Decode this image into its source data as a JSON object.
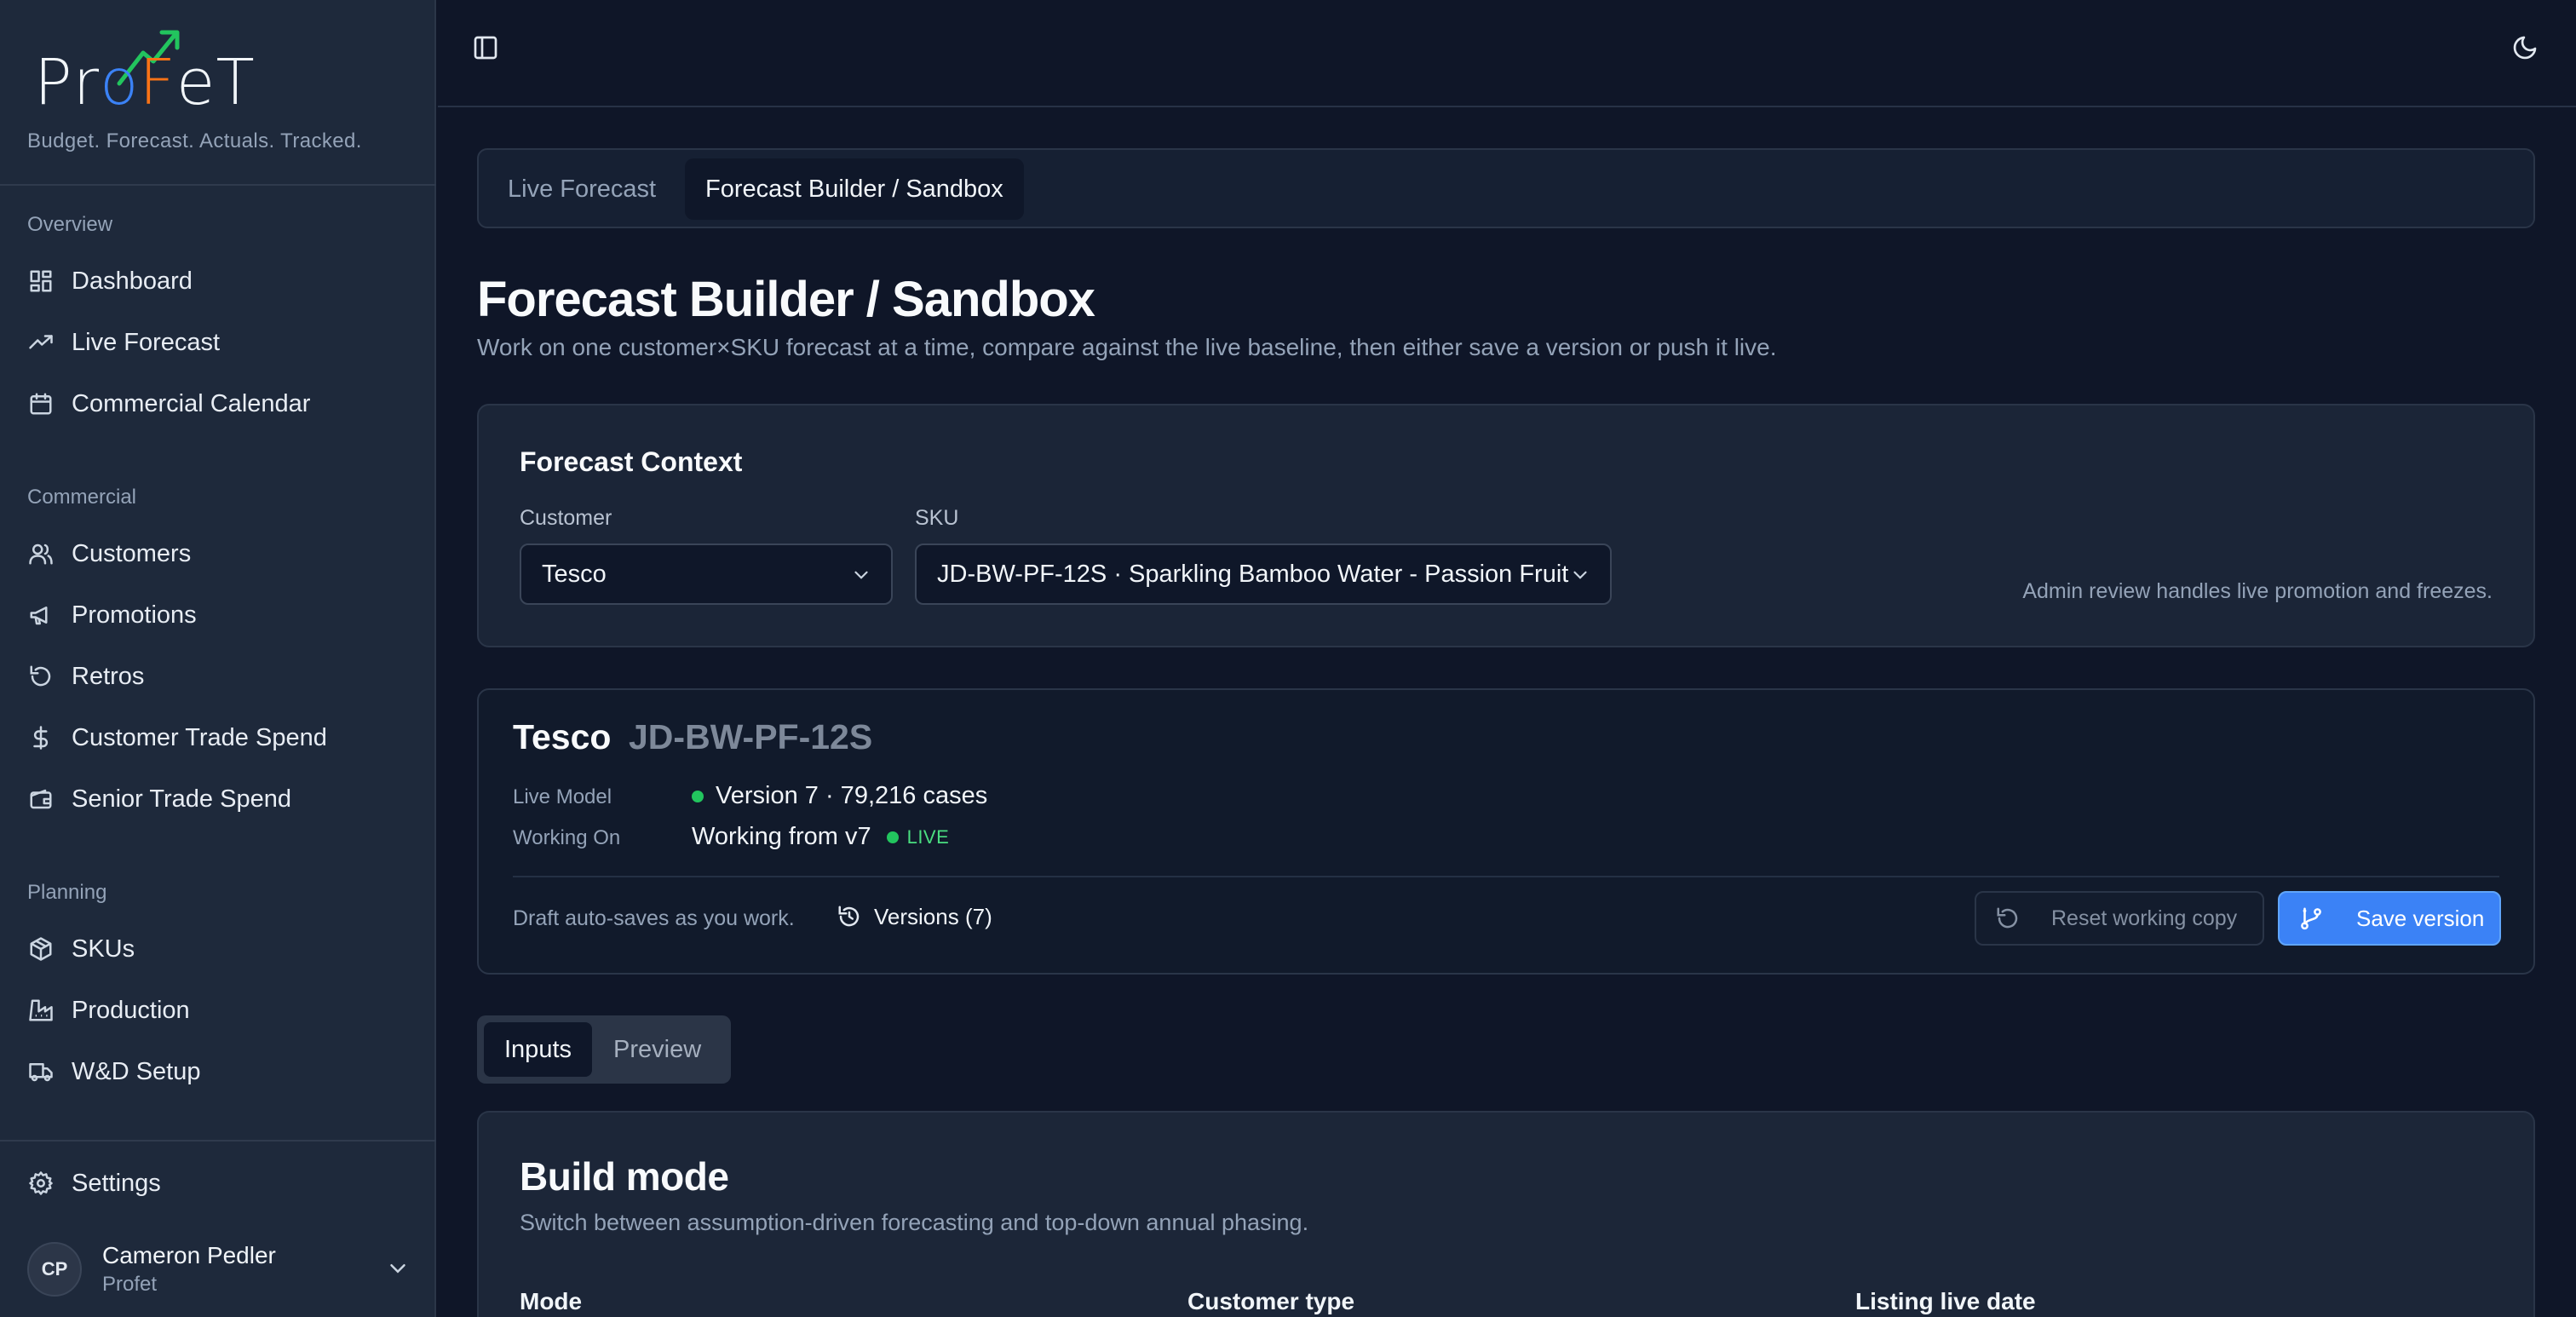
{
  "brand": {
    "logo_letters": [
      "P",
      "r",
      "o",
      "F",
      "e",
      "T"
    ],
    "tagline": "Budget. Forecast. Actuals. Tracked."
  },
  "sidebar": {
    "groups": [
      {
        "label": "Overview",
        "items": [
          {
            "label": "Dashboard",
            "icon": "dashboard-icon"
          },
          {
            "label": "Live Forecast",
            "icon": "trending-up-icon"
          },
          {
            "label": "Commercial Calendar",
            "icon": "calendar-icon"
          }
        ]
      },
      {
        "label": "Commercial",
        "items": [
          {
            "label": "Customers",
            "icon": "users-icon"
          },
          {
            "label": "Promotions",
            "icon": "megaphone-icon"
          },
          {
            "label": "Retros",
            "icon": "rotate-ccw-icon"
          },
          {
            "label": "Customer Trade Spend",
            "icon": "dollar-icon"
          },
          {
            "label": "Senior Trade Spend",
            "icon": "wallet-icon"
          }
        ]
      },
      {
        "label": "Planning",
        "items": [
          {
            "label": "SKUs",
            "icon": "package-icon"
          },
          {
            "label": "Production",
            "icon": "factory-icon"
          },
          {
            "label": "W&D Setup",
            "icon": "truck-icon"
          }
        ]
      }
    ],
    "settings_label": "Settings",
    "user": {
      "initials": "CP",
      "name": "Cameron Pedler",
      "org": "Profet"
    }
  },
  "tabs": [
    {
      "label": "Live Forecast",
      "active": false
    },
    {
      "label": "Forecast Builder / Sandbox",
      "active": true
    }
  ],
  "page": {
    "title": "Forecast Builder / Sandbox",
    "subtitle": "Work on one customer×SKU forecast at a time, compare against the live baseline, then either save a version or push it live."
  },
  "context": {
    "title": "Forecast Context",
    "customer_label": "Customer",
    "customer_value": "Tesco",
    "sku_label": "SKU",
    "sku_value": "JD-BW-PF-12S · Sparkling Bamboo Water - Passion Fruit",
    "note": "Admin review handles live promotion and freezes."
  },
  "summary": {
    "customer": "Tesco",
    "sku": "JD-BW-PF-12S",
    "live_model_label": "Live Model",
    "live_model_value": "Version 7 · 79,216 cases",
    "working_on_label": "Working On",
    "working_on_value": "Working from v7",
    "live_badge": "LIVE",
    "autosave": "Draft auto-saves as you work.",
    "versions_label": "Versions (7)",
    "reset_label": "Reset working copy",
    "save_label": "Save version"
  },
  "subtabs": [
    {
      "label": "Inputs",
      "active": true
    },
    {
      "label": "Preview",
      "active": false
    }
  ],
  "build": {
    "title": "Build mode",
    "subtitle": "Switch between assumption-driven forecasting and top-down annual phasing.",
    "mode_label": "Mode",
    "customer_type_label": "Customer type",
    "listing_live_date_label": "Listing live date"
  },
  "colors": {
    "accent": "#3b82f6",
    "live_green": "#22c55e",
    "logo_orange": "#f97316"
  }
}
